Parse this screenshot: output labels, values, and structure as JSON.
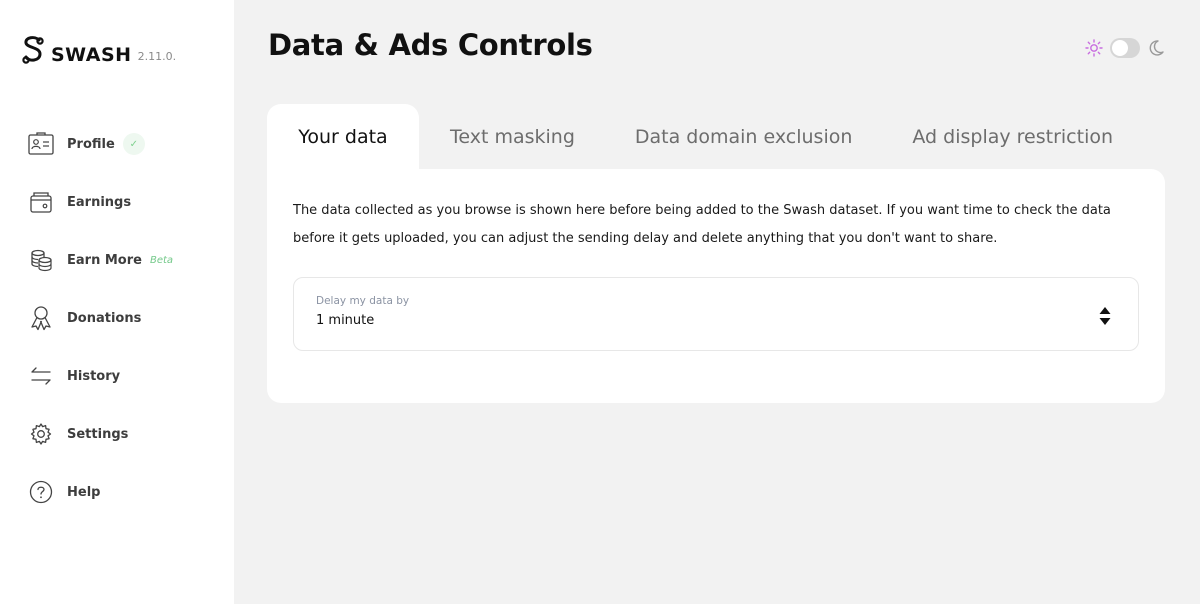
{
  "brand": {
    "name": "SWASH",
    "version": "2.11.0."
  },
  "sidebar": {
    "items": [
      {
        "label": "Profile",
        "icon": "profile-card-icon"
      },
      {
        "label": "Earnings",
        "icon": "wallet-icon"
      },
      {
        "label": "Earn More",
        "icon": "coins-stack-icon",
        "badge": "Beta"
      },
      {
        "label": "Donations",
        "icon": "ribbon-icon"
      },
      {
        "label": "History",
        "icon": "arrows-exchange-icon"
      },
      {
        "label": "Settings",
        "icon": "gear-icon"
      },
      {
        "label": "Help",
        "icon": "question-circle-icon"
      }
    ]
  },
  "header": {
    "title": "Data & Ads Controls"
  },
  "theme": {
    "mode": "light",
    "light_icon": "sun-icon",
    "dark_icon": "moon-icon",
    "accent": "#c86de0"
  },
  "tabs": [
    {
      "label": "Your data",
      "active": true
    },
    {
      "label": "Text masking",
      "active": false
    },
    {
      "label": "Data domain exclusion",
      "active": false
    },
    {
      "label": "Ad display restriction",
      "active": false
    }
  ],
  "panel": {
    "description_line1": "The data collected as you browse is shown here before being added to the Swash dataset. If you want time to check the data",
    "description_line2": "before it gets uploaded, you can adjust the sending delay and delete anything that you don't want to share.",
    "delay": {
      "label": "Delay my data by",
      "value": "1 minute"
    }
  }
}
